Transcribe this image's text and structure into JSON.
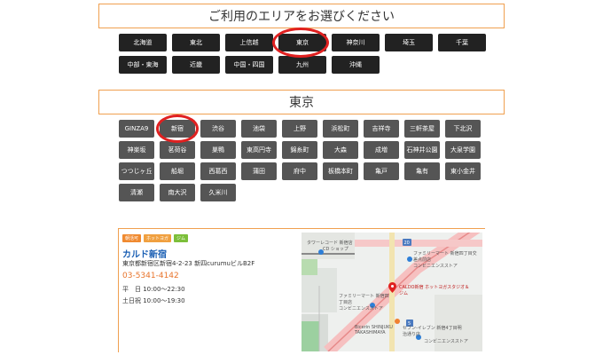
{
  "area_section": {
    "title": "ご利用のエリアをお選びください"
  },
  "regions": [
    "北海道",
    "東北",
    "上信越",
    "東京",
    "神奈川",
    "埼玉",
    "千葉",
    "中部・東海",
    "近畿",
    "中国・四国",
    "九州",
    "沖縄"
  ],
  "prefecture_section": {
    "title": "東京"
  },
  "cities": [
    "GINZA9",
    "新宿",
    "渋谷",
    "池袋",
    "上野",
    "浜松町",
    "吉祥寺",
    "三軒茶屋",
    "下北沢",
    "神楽坂",
    "茗荷谷",
    "巣鴨",
    "東高円寺",
    "錦糸町",
    "大森",
    "成増",
    "石神井公園",
    "大泉学園",
    "つつじヶ丘",
    "船堀",
    "西葛西",
    "蒲田",
    "府中",
    "板橋本町",
    "亀戸",
    "亀有",
    "東小金井",
    "清瀬",
    "南大沢",
    "久米川"
  ],
  "shop": {
    "tags": [
      "朝活可",
      "ホットヨガ",
      "ジム"
    ],
    "name": "カルド新宿",
    "address": "東京都新宿区新宿4-2-23 新四curumuビルB2F",
    "phone": "03-5341-4142",
    "hours_weekday": "平　日 10:00〜22:30",
    "hours_weekend": "土日祝 10:00〜19:30"
  },
  "map": {
    "labels": {
      "tower_records": "タワーレコード 新宿店",
      "cd_shop": "CD ショップ",
      "familymart_top": "ファミリーマート 新宿四丁目交差点前店",
      "convenience_top": "コンビニエンスストア",
      "calolo": "CALDO新宿 ホットヨガスタジオ＆ジム",
      "familymart_mid": "ファミリーマート 新宿四丁目店",
      "convenience_mid": "コンビニエンスストア",
      "bicerin": "Bicerin SHINJUKU TAKASHIMAYA",
      "seven": "セブン-イレブン 新宿4丁目明治通り店",
      "convenience_bot": "コンビニエンスストア",
      "route_20": "20",
      "route_5": "5"
    }
  },
  "colors": {
    "accent": "#f0a050",
    "region_bg": "#222222",
    "city_bg": "#555555",
    "highlight": "#e02020",
    "link": "#1a5fb4",
    "phone": "#e8732a"
  }
}
